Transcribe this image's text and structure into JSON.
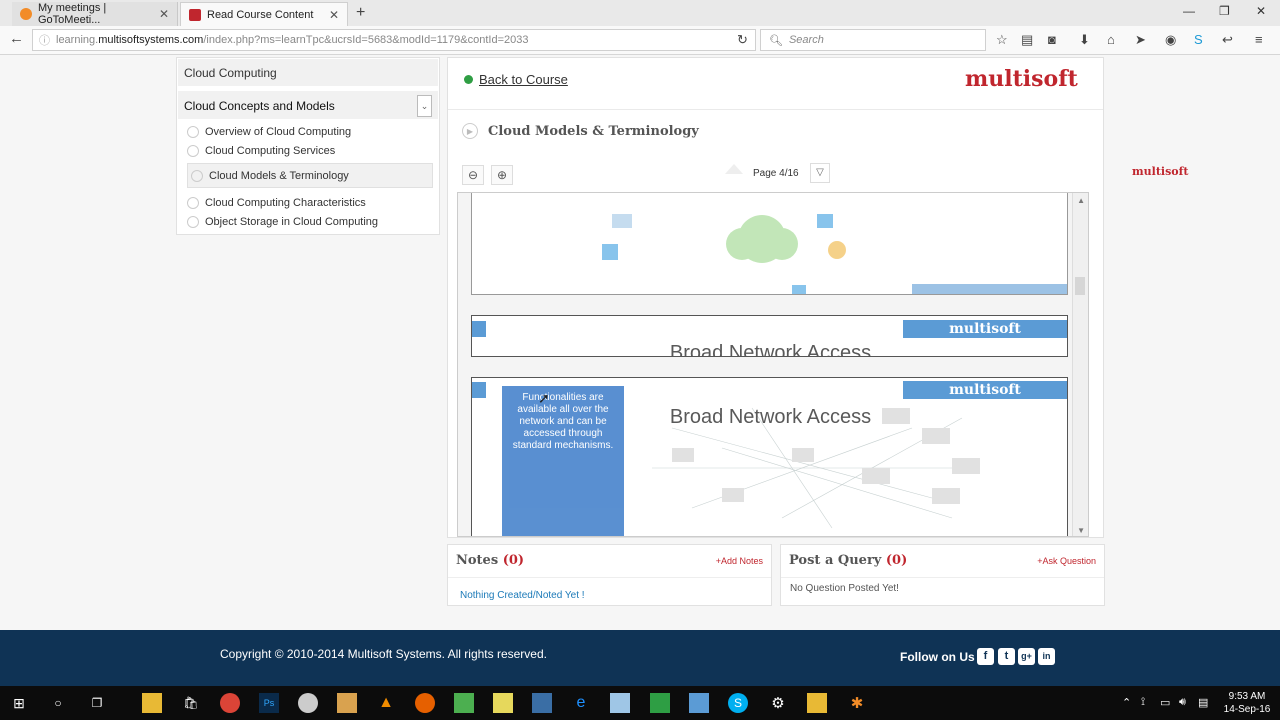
{
  "browser": {
    "tabs": [
      {
        "title": "My meetings | GoToMeeti...",
        "active": false
      },
      {
        "title": "Read Course Content",
        "active": true
      }
    ],
    "url_prefix": "learning.",
    "url_host": "multisoftsystems.com",
    "url_path": "/index.php?ms=learnTpc&ucrsId=5683&modId=1179&contId=2033",
    "search_placeholder": "Search"
  },
  "sidebar": {
    "course": "Cloud Computing",
    "module": "Cloud Concepts and Models",
    "topics": [
      {
        "label": "Overview of Cloud Computing"
      },
      {
        "label": "Cloud Computing Services"
      },
      {
        "label": "Cloud Models & Terminology"
      },
      {
        "label": "Cloud Computing Characteristics"
      },
      {
        "label": "Object Storage in Cloud Computing"
      }
    ]
  },
  "content": {
    "back_label": "Back to Course",
    "brand": "multisoft",
    "lesson_title": "Cloud Models & Terminology",
    "page_indicator": "Page 4/16",
    "slides": {
      "brand": "multisoft",
      "title": "Broad Network Access",
      "callout": "Functionalities are available all over the network and can be accessed through standard mechanisms."
    }
  },
  "side_brand": "multisoft",
  "notes": {
    "title": "Notes",
    "count": "(0)",
    "action": "+Add Notes",
    "empty": "Nothing Created/Noted Yet !"
  },
  "query": {
    "title": "Post a Query",
    "count": "(0)",
    "action": "+Ask Question",
    "empty": "No Question Posted Yet!"
  },
  "footer": {
    "copyright": "Copyright © 2010-2014 Multisoft Systems. All rights reserved.",
    "follow": "Follow on Us"
  },
  "taskbar": {
    "time": "9:53 AM",
    "date": "14-Sep-16"
  },
  "colors": {
    "brand_red": "#c0262e",
    "footer_bg": "#0f3355",
    "slide_blue": "#5b9bd5"
  }
}
